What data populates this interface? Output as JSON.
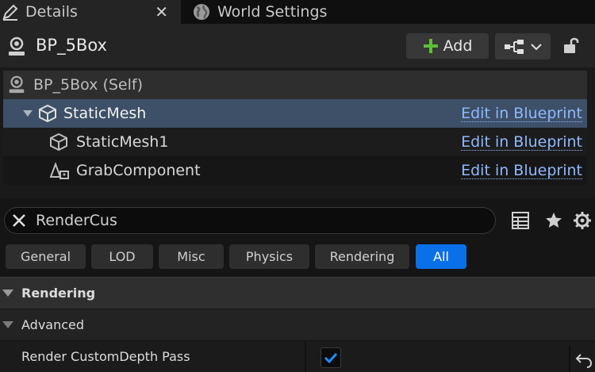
{
  "tabs": {
    "details": "Details",
    "world_settings": "World Settings",
    "close": "✕"
  },
  "header": {
    "actor_name": "BP_5Box",
    "add_label": "Add"
  },
  "tree": {
    "self_label": "BP_5Box (Self)",
    "items": [
      {
        "label": "StaticMesh",
        "link": "Edit in Blueprint"
      },
      {
        "label": "StaticMesh1",
        "link": "Edit in Blueprint"
      },
      {
        "label": "GrabComponent",
        "link": "Edit in Blueprint"
      }
    ]
  },
  "search": {
    "value": "RenderCus"
  },
  "filters": [
    "General",
    "LOD",
    "Misc",
    "Physics",
    "Rendering",
    "All"
  ],
  "active_filter": "All",
  "sections": {
    "rendering": "Rendering",
    "advanced": "Advanced"
  },
  "property": {
    "label": "Render CustomDepth Pass",
    "checked": true
  },
  "colors": {
    "accent": "#0a70e8",
    "selected_row": "#3d5067",
    "link": "#8fb8ff",
    "add_plus": "#5bbf3a"
  }
}
